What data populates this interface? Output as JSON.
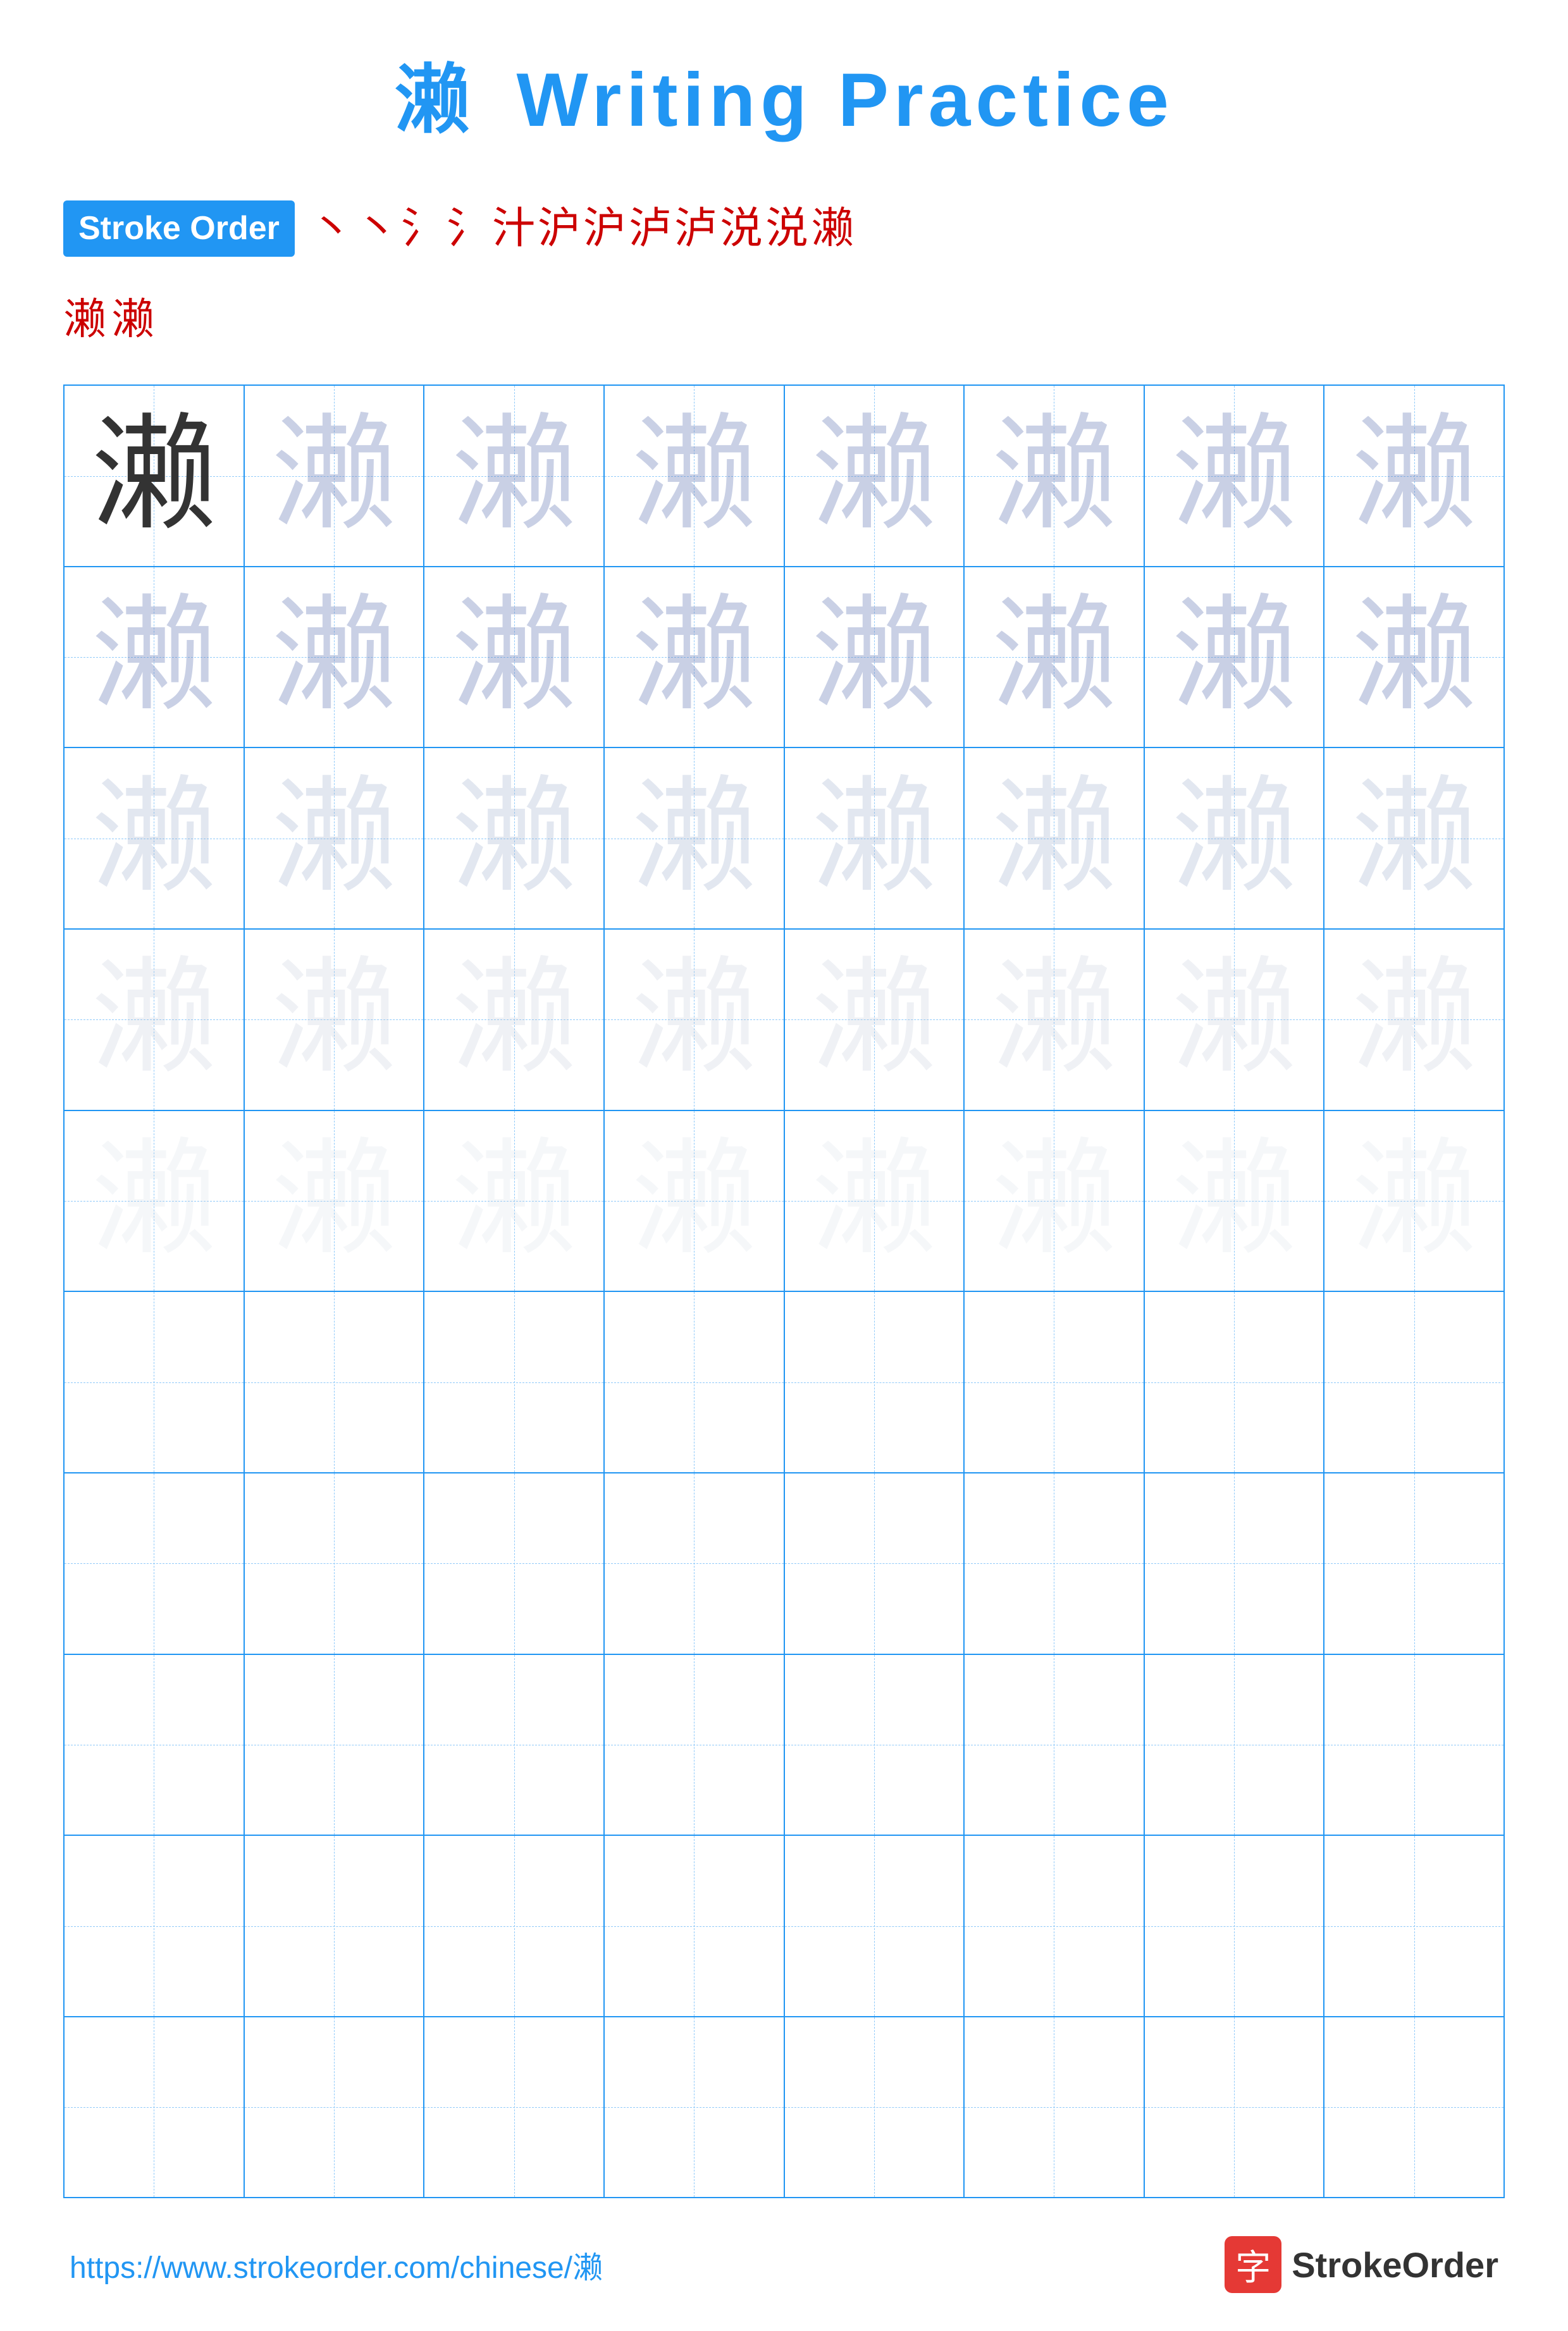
{
  "page": {
    "title": "濑 Writing Practice",
    "title_char": "濑",
    "title_text": "Writing Practice",
    "stroke_order_label": "Stroke Order",
    "stroke_chars": [
      "丶",
      "丶",
      "氵",
      "氵",
      "汁",
      "沪",
      "沪",
      "泸",
      "泸",
      "涚",
      "涚",
      "濑",
      "濑",
      "濑"
    ],
    "practice_char": "濑",
    "footer_url": "https://www.strokeorder.com/chinese/濑",
    "footer_logo_char": "字",
    "footer_logo_text": "StrokeOrder"
  },
  "grid": {
    "cols": 8,
    "rows": 10,
    "practice_rows": [
      {
        "type": "dark",
        "count": 8
      },
      {
        "type": "light1",
        "count": 8
      },
      {
        "type": "light2",
        "count": 8
      },
      {
        "type": "light3",
        "count": 8
      },
      {
        "type": "light4",
        "count": 8
      },
      {
        "type": "empty",
        "count": 8
      },
      {
        "type": "empty",
        "count": 8
      },
      {
        "type": "empty",
        "count": 8
      },
      {
        "type": "empty",
        "count": 8
      },
      {
        "type": "empty",
        "count": 8
      }
    ]
  }
}
